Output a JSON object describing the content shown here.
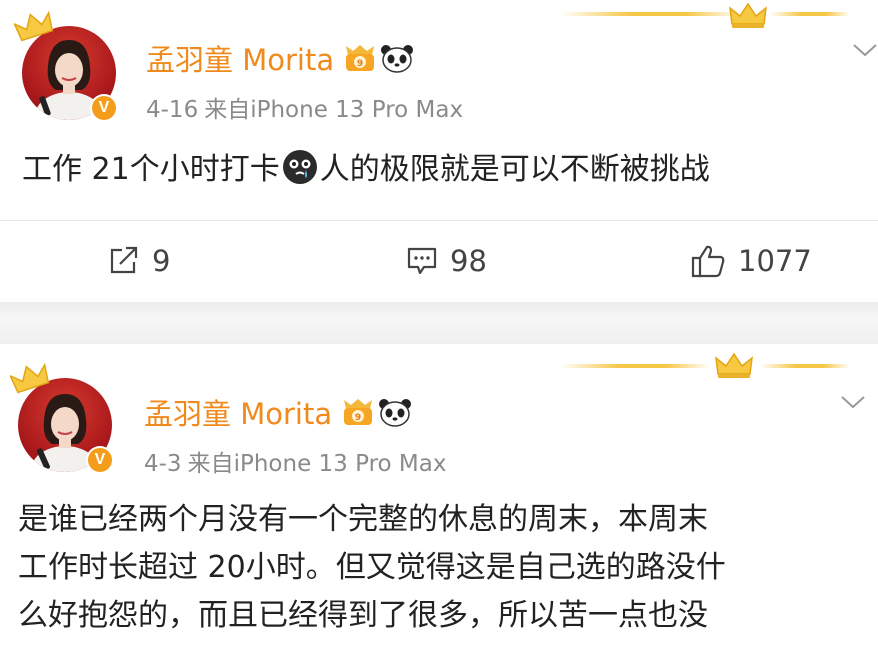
{
  "posts": [
    {
      "username": "孟羽童 Morita",
      "date": "4-16",
      "source": "来自iPhone 13 Pro Max",
      "text_lines": [
        "工作 21个小时打卡",
        "人的极限就是可以不断被挑战"
      ],
      "inline_emoji": "crying-face-icon",
      "stats": {
        "repost": "9",
        "comment": "98",
        "like": "1077"
      }
    },
    {
      "username": "孟羽童 Morita",
      "date": "4-3",
      "source": "来自iPhone 13 Pro Max",
      "text_lines": [
        "是谁已经两个月没有一个完整的休息的周末，本周末",
        "工作时长超过 20小时。但又觉得这是自己选的路没什",
        "么好抱怨的，而且已经得到了很多，所以苦一点也没"
      ]
    }
  ],
  "icons": [
    "crown-icon",
    "vip-badge-icon",
    "panda-icon",
    "verified-v-icon",
    "chevron-down-icon",
    "repost-icon",
    "comment-icon",
    "like-icon"
  ],
  "verified_letter": "V",
  "colors": {
    "username": "#f08a1c",
    "meta": "#8a8a8a",
    "verified": "#f49d1b",
    "gold_deco": "#f6c646",
    "avatar_bg": "#c0201f"
  }
}
